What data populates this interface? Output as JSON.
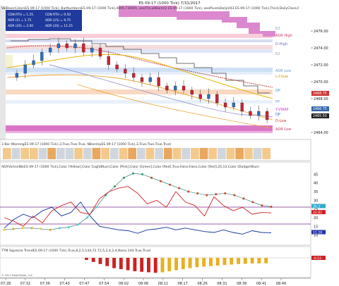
{
  "chart_title": "ES 09-17 (1000 Tick) 7/31/2017",
  "panel1": {
    "header": "ValBasicColorsES 09-17 (1000 Tick), BarNumbersES 09-17 (1000 Tick),4000,73000), aeeThrustBarsV2 ES 09-17 (1000 Tick), aeePivotsDailyV43 ES 09-17 (1000 Tick),Third,DailyClose,F",
    "info_box": [
      {
        "l": "CDN RTH = 1.25",
        "r": "CDN RTH = 9.50"
      },
      {
        "l": "ADR (5) = 1.75",
        "r": "ADR (15) = 9.75"
      },
      {
        "l": "ADR (20) = 2.00",
        "r": "ADR (20) = 11.25"
      }
    ],
    "price_ticks": [
      "2476.00",
      "2474.00",
      "2472.00",
      "2470.00",
      "2468.00",
      "2466.00",
      "2464.00"
    ],
    "right_labels": [
      {
        "text": "R3",
        "color": "#9999cc"
      },
      {
        "text": "ADR High",
        "color": "#cc3366"
      },
      {
        "text": "D-High",
        "color": "#6666cc"
      },
      {
        "text": "R2",
        "color": "#9999cc"
      },
      {
        "text": "ADR Low",
        "color": "#6699cc"
      },
      {
        "text": "L-Close",
        "color": "#cc9900"
      },
      {
        "text": "DP",
        "color": "#3399cc"
      },
      {
        "text": "PP",
        "color": "#6699cc"
      },
      {
        "text": "Y-VWAP",
        "color": "#cc33cc"
      },
      {
        "text": "OP",
        "color": "#3366cc"
      },
      {
        "text": "D-Low",
        "color": "#cc3333"
      },
      {
        "text": "ADR Low",
        "color": "#cc3366"
      }
    ],
    "price_tags": [
      {
        "text": "2468.75",
        "color": "#cc3333"
      },
      {
        "text": "2466.75",
        "color": "#3366aa"
      },
      {
        "text": "2465.50",
        "color": "#222222"
      }
    ]
  },
  "panel2": {
    "header": "3 Bar WarningES 09-17 (1000 Tick),3,True,True,True, NBarsUpES 09-17 (1000 Tick),3,True,True,True,True)"
  },
  "panel3": {
    "header": "ADXVortexNikES 09-17 (1000 Tick),Color [Yellow],Color [LightBlue],Color [Pink],Color [Green],Color [Red],True,False,False,Color [Red],25,14,Color (DodgerBlue)",
    "ticks": [
      "45",
      "40",
      "35",
      "30",
      "25",
      "20",
      "15",
      "10"
    ],
    "tags": [
      {
        "text": "26.3",
        "color": "#33aacc"
      },
      {
        "text": "22.81",
        "color": "#cc2222"
      },
      {
        "text": "11.28",
        "color": "#2233aa"
      }
    ]
  },
  "panel4": {
    "header": "TTM Squeeze TrendES 09-17 (1000 Tick),True,8,2,5,144,72,72,5,2,4,2,4,None,144,True,True)",
    "tag": {
      "text": "-0.53",
      "color": "#cc2222"
    },
    "footer": "© 2017 NinjaTrader, LLC"
  },
  "time_ticks": [
    "07:28",
    "07:32",
    "07:36",
    "07:43",
    "07:47",
    "07:54",
    "08:02",
    "08:06",
    "08:11",
    "08:17",
    "08:26",
    "08:31",
    "08:36",
    "08:41",
    "08:49"
  ],
  "chart_data": {
    "type": "line",
    "x_labels": [
      "07:28",
      "07:32",
      "07:36",
      "07:43",
      "07:47",
      "07:54",
      "08:02",
      "08:06",
      "08:11",
      "08:17",
      "08:26",
      "08:31",
      "08:36",
      "08:41",
      "08:49"
    ],
    "price_ylim": [
      2463.5,
      2478.5
    ],
    "candles_close": [
      2471.0,
      2472.0,
      2472.5,
      2473.5,
      2474.0,
      2474.5,
      2474.0,
      2474.5,
      2473.5,
      2474.0,
      2473.0,
      2472.0,
      2471.5,
      2471.0,
      2470.5,
      2470.0,
      2470.5,
      2469.5,
      2469.0,
      2469.5,
      2469.0,
      2468.5,
      2468.0,
      2468.5,
      2467.5,
      2467.0,
      2467.5,
      2466.5,
      2466.0,
      2466.5,
      2465.5
    ],
    "adx_ylim": [
      5,
      48
    ],
    "series": [
      {
        "name": "ADX",
        "values": [
          13,
          13.5,
          14,
          14,
          13.5,
          13,
          14,
          14.5,
          16,
          20,
          26,
          33,
          38,
          43,
          45.5,
          45,
          43,
          41,
          39,
          37,
          35,
          34,
          33,
          33.5,
          34,
          33,
          31,
          29,
          27,
          26.3
        ]
      },
      {
        "name": "DI+",
        "values": [
          14,
          19,
          22,
          20,
          24,
          26,
          21,
          23,
          29,
          21,
          15,
          14,
          13,
          12.5,
          11,
          13,
          13.5,
          14.5,
          13,
          14,
          13,
          12,
          11.5,
          13,
          11.5,
          10.5,
          12.5,
          11.5,
          11.28
        ]
      },
      {
        "name": "DI-",
        "values": [
          20,
          18,
          15,
          21,
          17,
          24,
          27,
          29,
          23,
          22,
          31,
          35,
          37,
          38,
          34,
          28,
          30,
          26,
          35,
          29,
          27,
          21,
          32,
          27,
          24,
          26,
          22,
          23,
          22.81
        ]
      }
    ],
    "squeeze_values": [
      -0.2,
      -0.4,
      -0.6,
      -0.8,
      -1.0,
      -1.1,
      -1.2,
      -1.3,
      -1.35,
      -1.4,
      -1.45,
      -1.4,
      -1.3,
      -1.2,
      -1.1,
      -1.0,
      -0.9,
      -0.85,
      -0.8,
      -0.75,
      -0.7,
      -0.65,
      -0.6,
      -0.58,
      -0.55,
      -0.54,
      -0.53
    ]
  }
}
